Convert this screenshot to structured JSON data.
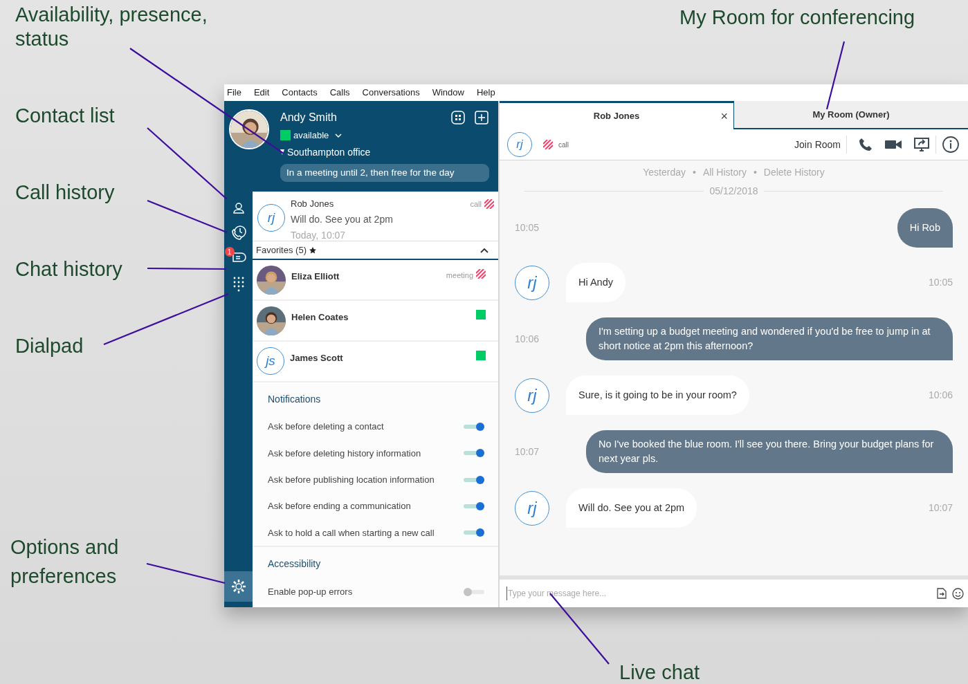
{
  "callouts": [
    {
      "text": "Availability, presence, status"
    },
    {
      "text": "Contact list"
    },
    {
      "text": "Call history"
    },
    {
      "text": "Chat history"
    },
    {
      "text": "Dialpad"
    },
    {
      "text": "Options and preferences"
    },
    {
      "text": "My Room for conferencing"
    },
    {
      "text": "Live chat"
    }
  ],
  "menu": [
    "File",
    "Edit",
    "Contacts",
    "Calls",
    "Conversations",
    "Window",
    "Help"
  ],
  "profile": {
    "name": "Andy Smith",
    "status": {
      "label": "available",
      "color": "#00cc66"
    },
    "location": "Southampton office",
    "note": "In a meeting until 2, then free for the day"
  },
  "rail": {
    "chat_badge": "1"
  },
  "recent": {
    "initials": "rj",
    "name": "Rob Jones",
    "message": "Will do. See you at 2pm",
    "time": "Today, 10:07",
    "presence": {
      "kind": "busy",
      "label": "call"
    }
  },
  "favorites": {
    "title": "Favorites (5)",
    "expanded": true,
    "contacts": [
      {
        "name": "Eliza Elliott",
        "presence": {
          "kind": "busy",
          "label": "meeting"
        }
      },
      {
        "name": "Helen Coates",
        "presence": {
          "kind": "available"
        }
      },
      {
        "kind": "initials",
        "name": "James Scott",
        "initials": "js",
        "presence": {
          "kind": "available"
        }
      }
    ]
  },
  "settings": [
    {
      "title": "Notifications",
      "items": [
        {
          "label": "Ask before deleting a contact",
          "on": true
        },
        {
          "label": "Ask before deleting history information",
          "on": true
        },
        {
          "label": "Ask before publishing location information",
          "on": true
        },
        {
          "label": "Ask before ending a communication",
          "on": true
        },
        {
          "label": "Ask to hold a call when starting a new call",
          "on": true
        }
      ]
    },
    {
      "title": "Accessibility",
      "items": [
        {
          "label": "Enable pop-up errors",
          "on": false
        }
      ]
    }
  ],
  "conversation": {
    "tabs": [
      {
        "label": "Rob Jones",
        "selected": true,
        "close": "×"
      },
      {
        "label": "My Room (Owner)",
        "selected": false
      }
    ],
    "header": {
      "initials": "rj",
      "presence": {
        "kind": "busy",
        "label": "call"
      },
      "join": "Join Room"
    },
    "history_links": [
      "Yesterday",
      "All History",
      "Delete History"
    ],
    "separator": "•",
    "date": "05/12/2018",
    "messages": [
      {
        "kind": "outgoing",
        "text": "Hi Rob",
        "time": "10:05"
      },
      {
        "kind": "incoming",
        "initials": "rj",
        "text": "Hi Andy",
        "time": "10:05"
      },
      {
        "kind": "outgoing",
        "text": "I'm setting up a budget meeting and wondered if you'd be free to jump in at short notice at 2pm this afternoon?",
        "time": "10:06"
      },
      {
        "kind": "incoming",
        "initials": "rj",
        "text": "Sure, is it going to be in your room?",
        "time": "10:06"
      },
      {
        "kind": "outgoing",
        "text": "No I've booked the blue room. I'll see you there. Bring your budget plans for next year pls.",
        "time": "10:07"
      },
      {
        "kind": "incoming",
        "initials": "rj",
        "text": "Will do. See you at 2pm",
        "time": "10:07"
      }
    ],
    "composer": {
      "placeholder": "Type your message here..."
    }
  }
}
